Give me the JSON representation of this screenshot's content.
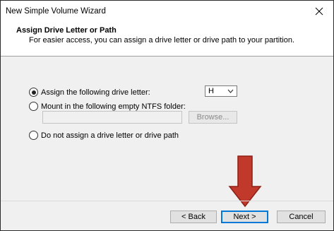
{
  "window": {
    "title": "New Simple Volume Wizard"
  },
  "header": {
    "title": "Assign Drive Letter or Path",
    "subtitle": "For easier access, you can assign a drive letter or drive path to your partition."
  },
  "options": {
    "assign_letter": {
      "label": "Assign the following drive letter:",
      "checked": true
    },
    "mount_folder": {
      "label": "Mount in the following empty NTFS folder:",
      "checked": false
    },
    "no_assign": {
      "label": "Do not assign a drive letter or drive path",
      "checked": false
    }
  },
  "drive_letter": {
    "value": "H"
  },
  "folder_path": {
    "value": ""
  },
  "buttons": {
    "browse": "Browse...",
    "back": "< Back",
    "next": "Next >",
    "cancel": "Cancel"
  },
  "colors": {
    "annotation_arrow": "#c0392b"
  }
}
